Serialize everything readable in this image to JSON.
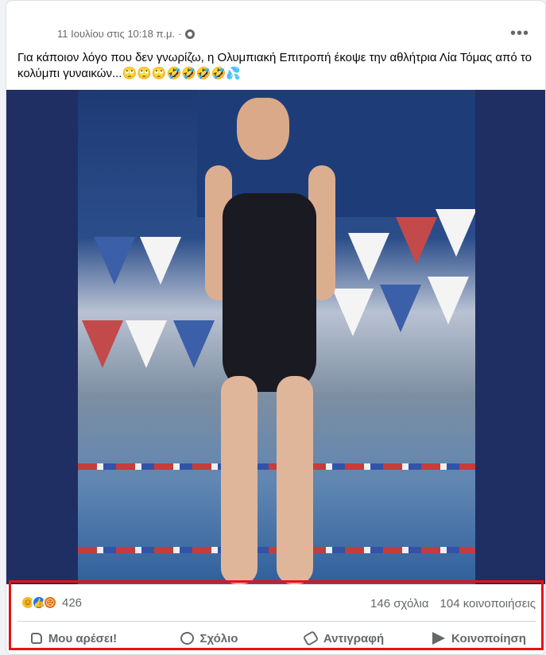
{
  "post": {
    "timestamp": "11 Ιουλίου στις 10:18 π.μ.",
    "dot": "·",
    "more_label": "•••",
    "text": "Για κάποιον λόγο που δεν γνωρίζω, η Ολυμπιακή Επιτροπή έκοψε την αθλήτρια Λία Τόμας από το κολύμπι γυναικών...🙄🙄🙄🤣🤣🤣🤣💦"
  },
  "stats": {
    "reaction_icons": [
      "haha-icon",
      "like-icon",
      "angry-icon"
    ],
    "reaction_count": "426",
    "comments": "146 σχόλια",
    "shares": "104 κοινοποιήσεις"
  },
  "actions": {
    "like": "Μου αρέσει!",
    "comment": "Σχόλιο",
    "copy": "Αντιγραφή",
    "share": "Κοινοποίηση"
  },
  "colors": {
    "highlight": "#e8101a",
    "muted_text": "#65676b",
    "like_blue": "#1877f2"
  }
}
